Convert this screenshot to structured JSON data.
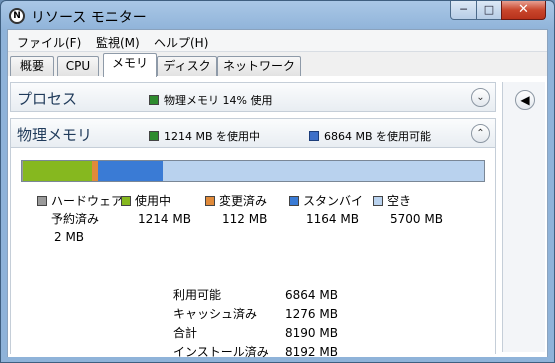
{
  "window": {
    "title": "リソース モニター",
    "min": "─",
    "max": "□",
    "close": "✕"
  },
  "menu": [
    "ファイル(F)",
    "監視(M)",
    "ヘルプ(H)"
  ],
  "tabs": [
    {
      "label": "概要",
      "active": false
    },
    {
      "label": "CPU",
      "active": false
    },
    {
      "label": "メモリ",
      "active": true
    },
    {
      "label": "ディスク",
      "active": false
    },
    {
      "label": "ネットワーク",
      "active": false
    }
  ],
  "process_section": {
    "title": "プロセス",
    "stat": "物理メモリ 14% 使用",
    "chevron": "⌄",
    "stat_color": "#2e8b2e"
  },
  "physical_section": {
    "title": "物理メモリ",
    "in_use": "1214 MB を使用中",
    "available": "6864 MB を使用可能",
    "chevron": "⌃"
  },
  "memory_bar": [
    {
      "name": "hardware-reserved",
      "mb": 2,
      "color": "#9a9a9a"
    },
    {
      "name": "in-use",
      "mb": 1214,
      "color": "#86b81f"
    },
    {
      "name": "modified",
      "mb": 112,
      "color": "#e08a3a"
    },
    {
      "name": "standby",
      "mb": 1164,
      "color": "#3a7bd5"
    },
    {
      "name": "free",
      "mb": 5700,
      "color": "#b9d2ee"
    }
  ],
  "legend": [
    {
      "label": "ハードウェア予約済み",
      "value": "2 MB",
      "color": "#9a9a9a"
    },
    {
      "label": "使用中",
      "value": "1214 MB",
      "color": "#86b81f"
    },
    {
      "label": "変更済み",
      "value": "112 MB",
      "color": "#e08a3a"
    },
    {
      "label": "スタンバイ",
      "value": "1164 MB",
      "color": "#3a7bd5"
    },
    {
      "label": "空き",
      "value": "5700 MB",
      "color": "#b9d2ee"
    }
  ],
  "stats": [
    {
      "label": "利用可能",
      "value": "6864 MB"
    },
    {
      "label": "キャッシュ済み",
      "value": "1276 MB"
    },
    {
      "label": "合計",
      "value": "8190 MB"
    },
    {
      "label": "インストール済み",
      "value": "8192 MB"
    }
  ],
  "right_pane": {
    "collapse_icon": "◀"
  }
}
